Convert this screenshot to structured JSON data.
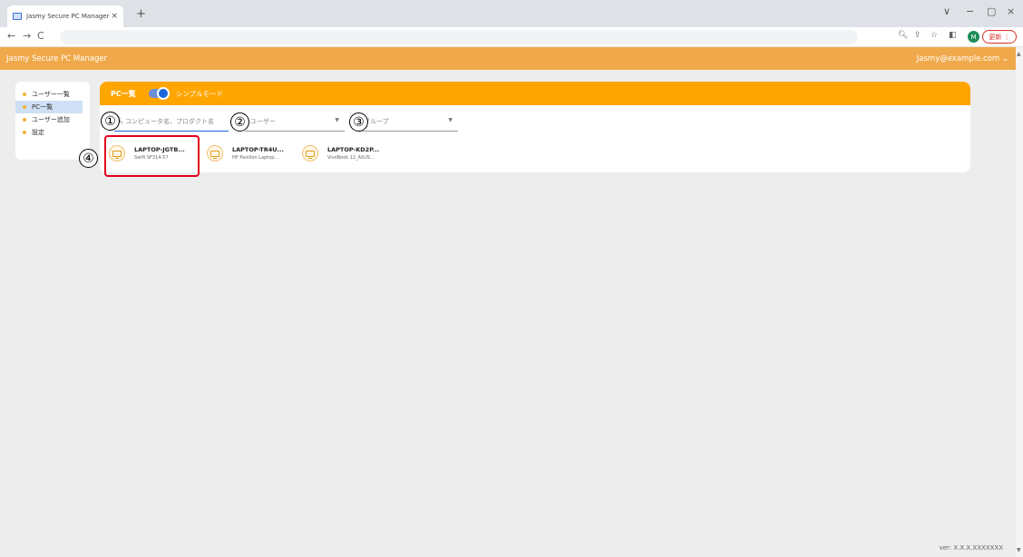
{
  "browser": {
    "tab_title": "Jasmy Secure PC Manager",
    "tab_close": "×",
    "new_tab": "+",
    "window_controls": [
      "∨",
      "−",
      "▢",
      "×"
    ],
    "update_label": "更新 ⋮",
    "profile_initial": "M"
  },
  "app": {
    "title": "Jasmy Secure PC Manager",
    "user_email": "Jasmy@example.com ⌄",
    "version": "ver: X.X.X.XXXXXXX"
  },
  "sidebar": {
    "items": [
      {
        "label": "ユーザー一覧"
      },
      {
        "label": "PC一覧"
      },
      {
        "label": "ユーザー追加"
      },
      {
        "label": "設定"
      }
    ]
  },
  "panel": {
    "title": "PC一覧",
    "mode_label": "シンプルモード",
    "search_placeholder": "コンピュータ名、プロダクト名",
    "user_select_placeholder": "ユーザー",
    "group_select_placeholder": "グループ"
  },
  "pcs": [
    {
      "name": "LAPTOP-JGTB...",
      "model": "Swift SF314-57"
    },
    {
      "name": "LAPTOP-TR4U...",
      "model": "HP Pavilion Laptop..."
    },
    {
      "name": "LAPTOP-KD2P...",
      "model": "VivoBook 12_ASUS..."
    }
  ],
  "callouts": [
    "①",
    "②",
    "③",
    "④"
  ],
  "colors": {
    "header": "#f0a94a",
    "panel_header": "#ffa500",
    "highlight": "#e0001a"
  }
}
